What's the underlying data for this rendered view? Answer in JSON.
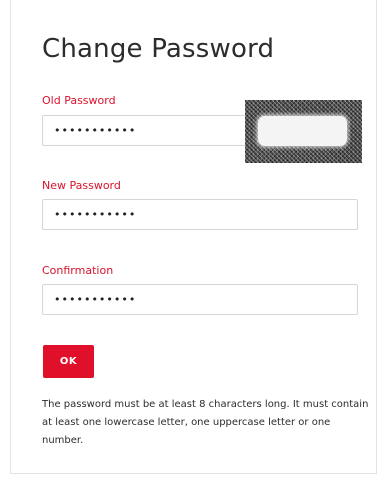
{
  "form": {
    "title": "Change Password",
    "old_password": {
      "label": "Old Password",
      "value": "qwertyuiop1"
    },
    "new_password": {
      "label": "New Password",
      "value": "qwertyuiop1"
    },
    "confirmation": {
      "label": "Confirmation",
      "value": "qwertyuiop1"
    },
    "submit_label": "OK",
    "hint": "The password must be at least 8 characters long. It must contain at least one lowercase letter, one uppercase letter or one number."
  }
}
